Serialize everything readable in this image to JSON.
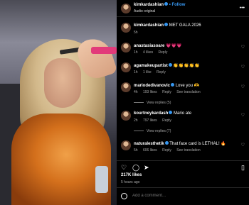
{
  "header": {
    "username": "kimkardashian",
    "follow_label": "• Follow",
    "audio": "Audio original"
  },
  "caption": {
    "username": "kimkardashian",
    "text": "MET GALA 2026",
    "time": "5h"
  },
  "comments": [
    {
      "username": "anastasiasoare",
      "text": "💗💗💗",
      "time": "1h",
      "likes": "4 likes",
      "reply": "Reply",
      "verified": false
    },
    {
      "username": "agamakeupartist",
      "text": "👏👏👏👏👏",
      "time": "1h",
      "likes": "1 like",
      "reply": "Reply",
      "verified": true
    },
    {
      "username": "mariodedivanovic",
      "text": "Love you 🫶",
      "time": "4h",
      "likes": "193 likes",
      "reply": "Reply",
      "see_translation": "See translation",
      "verified": true,
      "view_replies": "View replies (5)"
    },
    {
      "username": "kourtneykardash",
      "text": "Mario ate",
      "time": "2h",
      "likes": "797 likes",
      "reply": "Reply",
      "verified": true,
      "view_replies": "View replies (7)"
    },
    {
      "username": "naturalesthetik",
      "text": "That face card is LETHAL! 🔥",
      "time": "5h",
      "likes": "606 likes",
      "reply": "Reply",
      "see_translation": "See translation",
      "verified": true
    }
  ],
  "actions": {
    "likes": "217K likes",
    "time": "5 hours ago"
  },
  "composer": {
    "placeholder": "Add a comment..."
  },
  "icons": {
    "like": "heart-icon",
    "comment": "comment-icon",
    "share": "send-icon",
    "save": "bookmark-icon",
    "more": "more-icon"
  }
}
